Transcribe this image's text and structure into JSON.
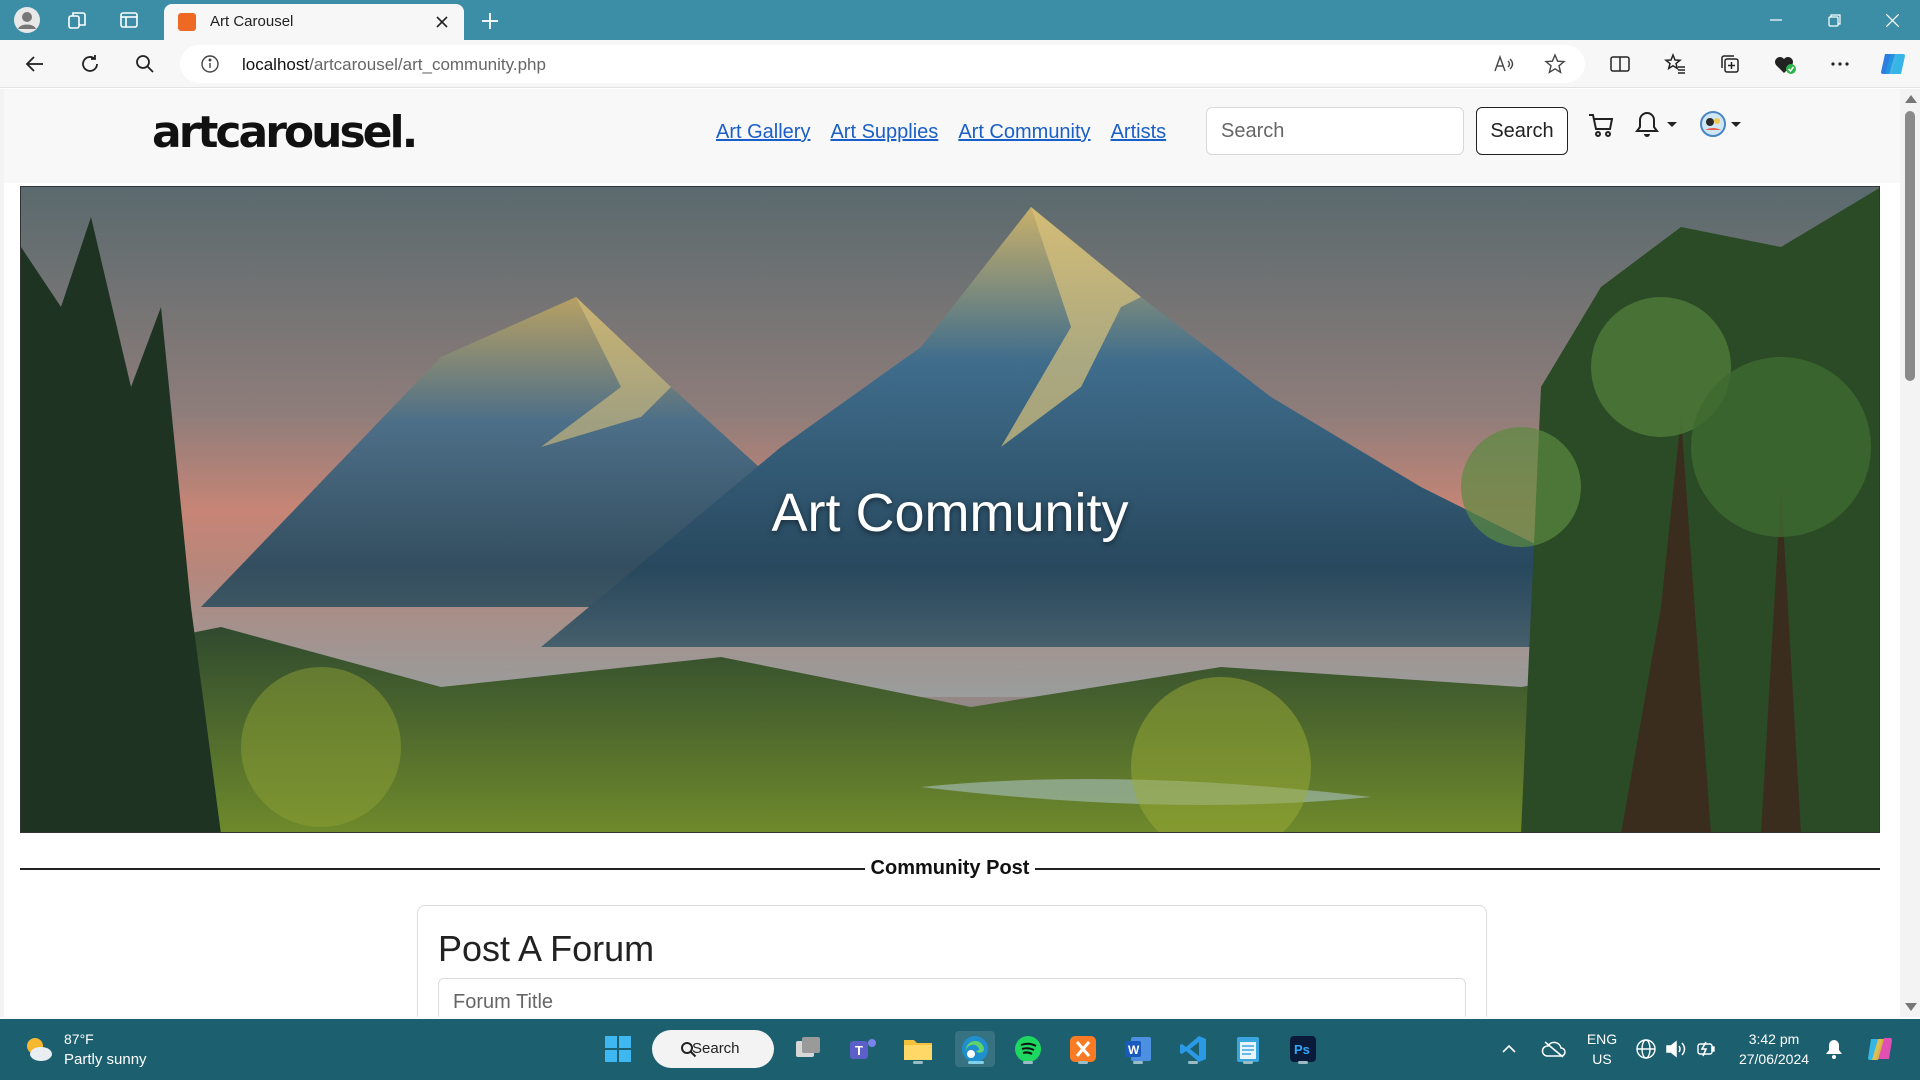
{
  "browser": {
    "tab_title": "Art Carousel",
    "url_host": "localhost",
    "url_path": "/artcarousel/art_community.php"
  },
  "site": {
    "logo_text": "artcarousel.",
    "nav_links": [
      "Art Gallery",
      "Art Supplies",
      "Art Community",
      "Artists"
    ],
    "search_placeholder": "Search",
    "search_button": "Search"
  },
  "hero": {
    "title": "Art Community"
  },
  "section": {
    "divider_label": "Community Post"
  },
  "forum_form": {
    "heading": "Post A Forum",
    "title_placeholder": "Forum Title"
  },
  "taskbar": {
    "weather_temp": "87°F",
    "weather_desc": "Partly sunny",
    "search_label": "Search",
    "lang_top": "ENG",
    "lang_bottom": "US",
    "time": "3:42 pm",
    "date": "27/06/2024"
  },
  "colors": {
    "titlebar": "#3c8ea6",
    "taskbar": "#1c5f6f",
    "link": "#1a5fc9",
    "accent_orange": "#ee6a24"
  },
  "icons": {
    "titlebar": [
      "profile-icon",
      "workspaces-icon",
      "tab-actions-icon"
    ],
    "address_bar": [
      "back-icon",
      "refresh-icon",
      "search-icon",
      "info-icon",
      "read-aloud-icon",
      "favorite-star-icon"
    ],
    "toolbar": [
      "split-screen-icon",
      "favorites-icon",
      "collections-icon",
      "browser-essentials-icon",
      "more-icon",
      "copilot-icon"
    ],
    "site": [
      "cart-icon",
      "bell-icon",
      "user-avatar-icon"
    ]
  }
}
